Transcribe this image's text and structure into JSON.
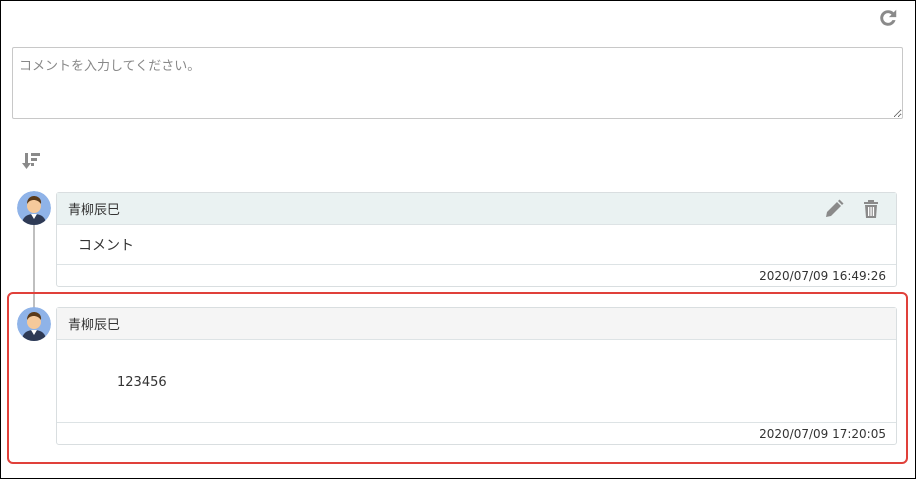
{
  "icons": {
    "refresh": "refresh-icon",
    "sort": "sort-descending-icon",
    "edit": "pencil-icon",
    "delete": "trash-icon"
  },
  "comment_input": {
    "placeholder": "コメントを入力してください。",
    "value": ""
  },
  "comments": [
    {
      "author": "青柳辰巳",
      "body": "コメント",
      "timestamp": "2020/07/09 16:49:26"
    },
    {
      "author": "青柳辰巳",
      "body": "123456",
      "timestamp": "2020/07/09 17:20:05"
    }
  ],
  "colors": {
    "highlight": "#e0403a",
    "icon_gray": "#888888"
  }
}
